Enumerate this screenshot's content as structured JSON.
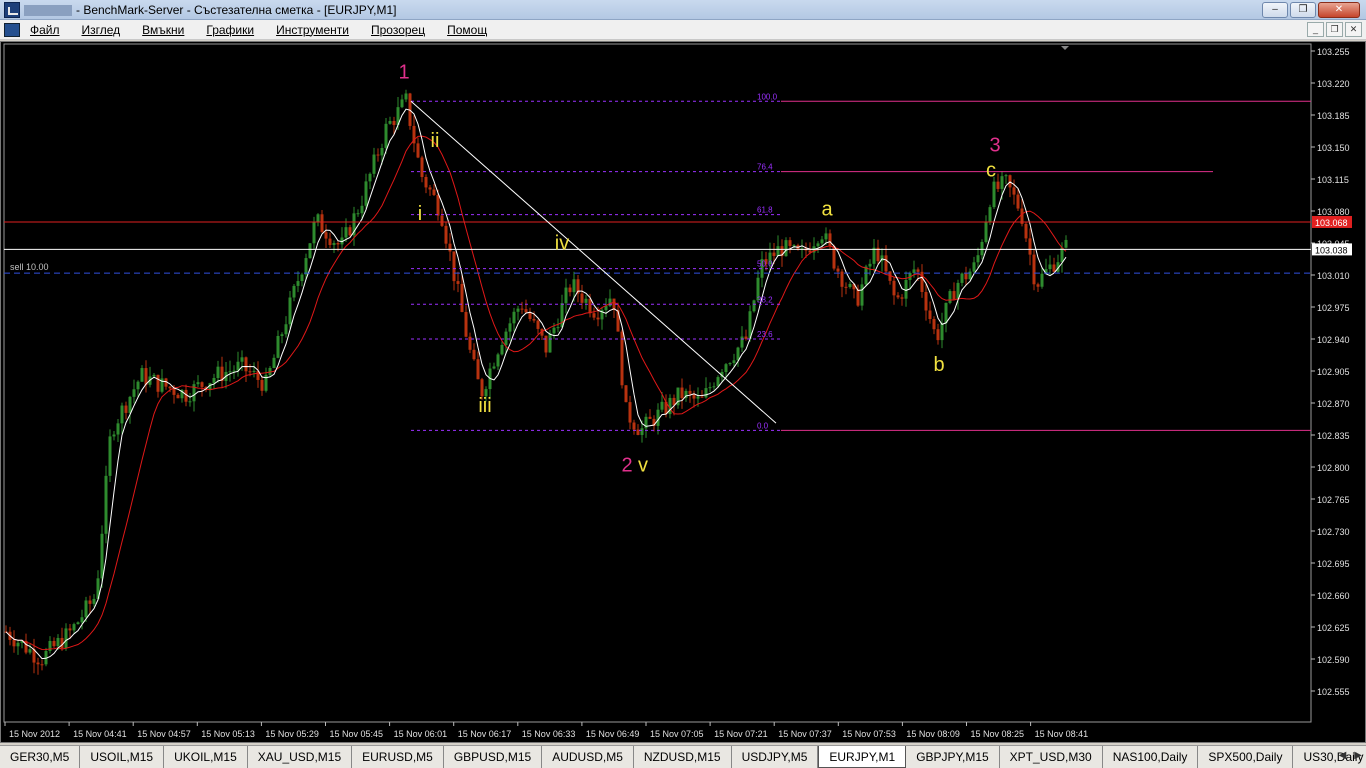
{
  "window": {
    "title": "- BenchMark-Server - Състезателна сметка - [EURJPY,M1]",
    "buttons": {
      "minimize": "–",
      "maximize": "❐",
      "close": "✕"
    }
  },
  "menu": {
    "items": [
      "Файл",
      "Изглед",
      "Вмъкни",
      "Графики",
      "Инструменти",
      "Прозорец",
      "Помощ"
    ],
    "mdi": {
      "minimize": "_",
      "restore": "❐",
      "close": "✕"
    }
  },
  "chart": {
    "symbol": "EURJPY",
    "timeframe": "M1",
    "bid_price_label": "103.038",
    "ask_price_label": "103.068",
    "order_label": "sell 10.00",
    "price_axis": [
      "103.255",
      "103.220",
      "103.185",
      "103.150",
      "103.115",
      "103.080",
      "103.045",
      "103.010",
      "102.975",
      "102.940",
      "102.905",
      "102.870",
      "102.835",
      "102.800",
      "102.765",
      "102.730",
      "102.695",
      "102.660",
      "102.625",
      "102.590",
      "102.555"
    ],
    "time_axis": [
      "15 Nov 2012",
      "15 Nov 04:41",
      "15 Nov 04:57",
      "15 Nov 05:13",
      "15 Nov 05:29",
      "15 Nov 05:45",
      "15 Nov 06:01",
      "15 Nov 06:17",
      "15 Nov 06:33",
      "15 Nov 06:49",
      "15 Nov 07:05",
      "15 Nov 07:21",
      "15 Nov 07:37",
      "15 Nov 07:53",
      "15 Nov 08:09",
      "15 Nov 08:25",
      "15 Nov 08:41"
    ],
    "fib_levels": [
      "100.0",
      "76.4",
      "61.8",
      "50.0",
      "38.2",
      "23.6",
      "0.0"
    ],
    "wave_labels": {
      "w1": "1",
      "w2": "2",
      "w3": "3",
      "i": "i",
      "ii": "ii",
      "iii": "iii",
      "iv": "iv",
      "v": "v",
      "a": "a",
      "b": "b",
      "c": "c"
    },
    "colors": {
      "background": "#000000",
      "bull_candle": "#2e8b2e",
      "bear_candle": "#b8320f",
      "fast_ma": "#ffffff",
      "slow_ma": "#e01818",
      "fib": "#9b30ff",
      "wave_major": "#e0308c",
      "wave_minor": "#f0e040"
    }
  },
  "tabs": {
    "items": [
      "GER30,M5",
      "USOIL,M15",
      "UKOIL,M15",
      "XAU_USD,M15",
      "EURUSD,M5",
      "GBPUSD,M15",
      "AUDUSD,M5",
      "NZDUSD,M15",
      "USDJPY,M5",
      "EURJPY,M1",
      "GBPJPY,M15",
      "XPT_USD,M30",
      "NAS100,Daily",
      "SPX500,Daily",
      "US30,Daily"
    ],
    "active": "EURJPY,M1",
    "scroll_left": "◀",
    "scroll_right": "▶"
  }
}
